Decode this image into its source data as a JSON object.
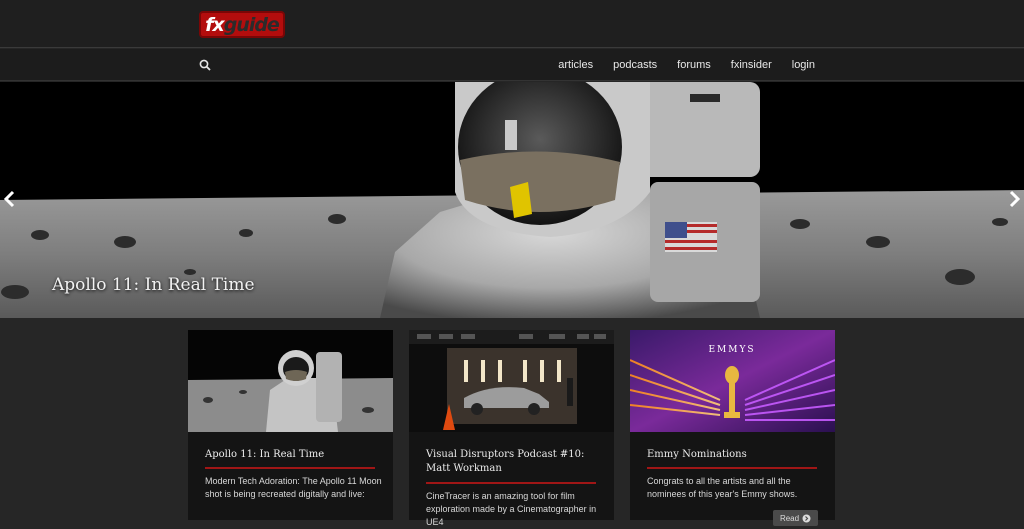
{
  "header": {
    "logo_fx": "fx",
    "logo_guide": "guide"
  },
  "nav": {
    "items": [
      {
        "label": "articles"
      },
      {
        "label": "podcasts"
      },
      {
        "label": "forums"
      },
      {
        "label": "fxinsider"
      },
      {
        "label": "login"
      }
    ]
  },
  "hero": {
    "title": "Apollo 11: In Real Time"
  },
  "cards": [
    {
      "title": "Apollo 11: In Real Time",
      "text": "Modern Tech Adoration: The Apollo 11 Moon shot is being recreated digitally and live:"
    },
    {
      "title": "Visual Disruptors Podcast #10: Matt Workman",
      "text": "CineTracer is an amazing tool for film exploration made by a Cinematographer in UE4"
    },
    {
      "title": "Emmy Nominations",
      "text": "Congrats to all the artists and all the nominees of this year's Emmy shows.",
      "button": "Read",
      "image_label": "EMMYS"
    }
  ],
  "colors": {
    "brand_red": "#b30d0d",
    "accent_rule": "#a01616",
    "background": "#262626"
  }
}
